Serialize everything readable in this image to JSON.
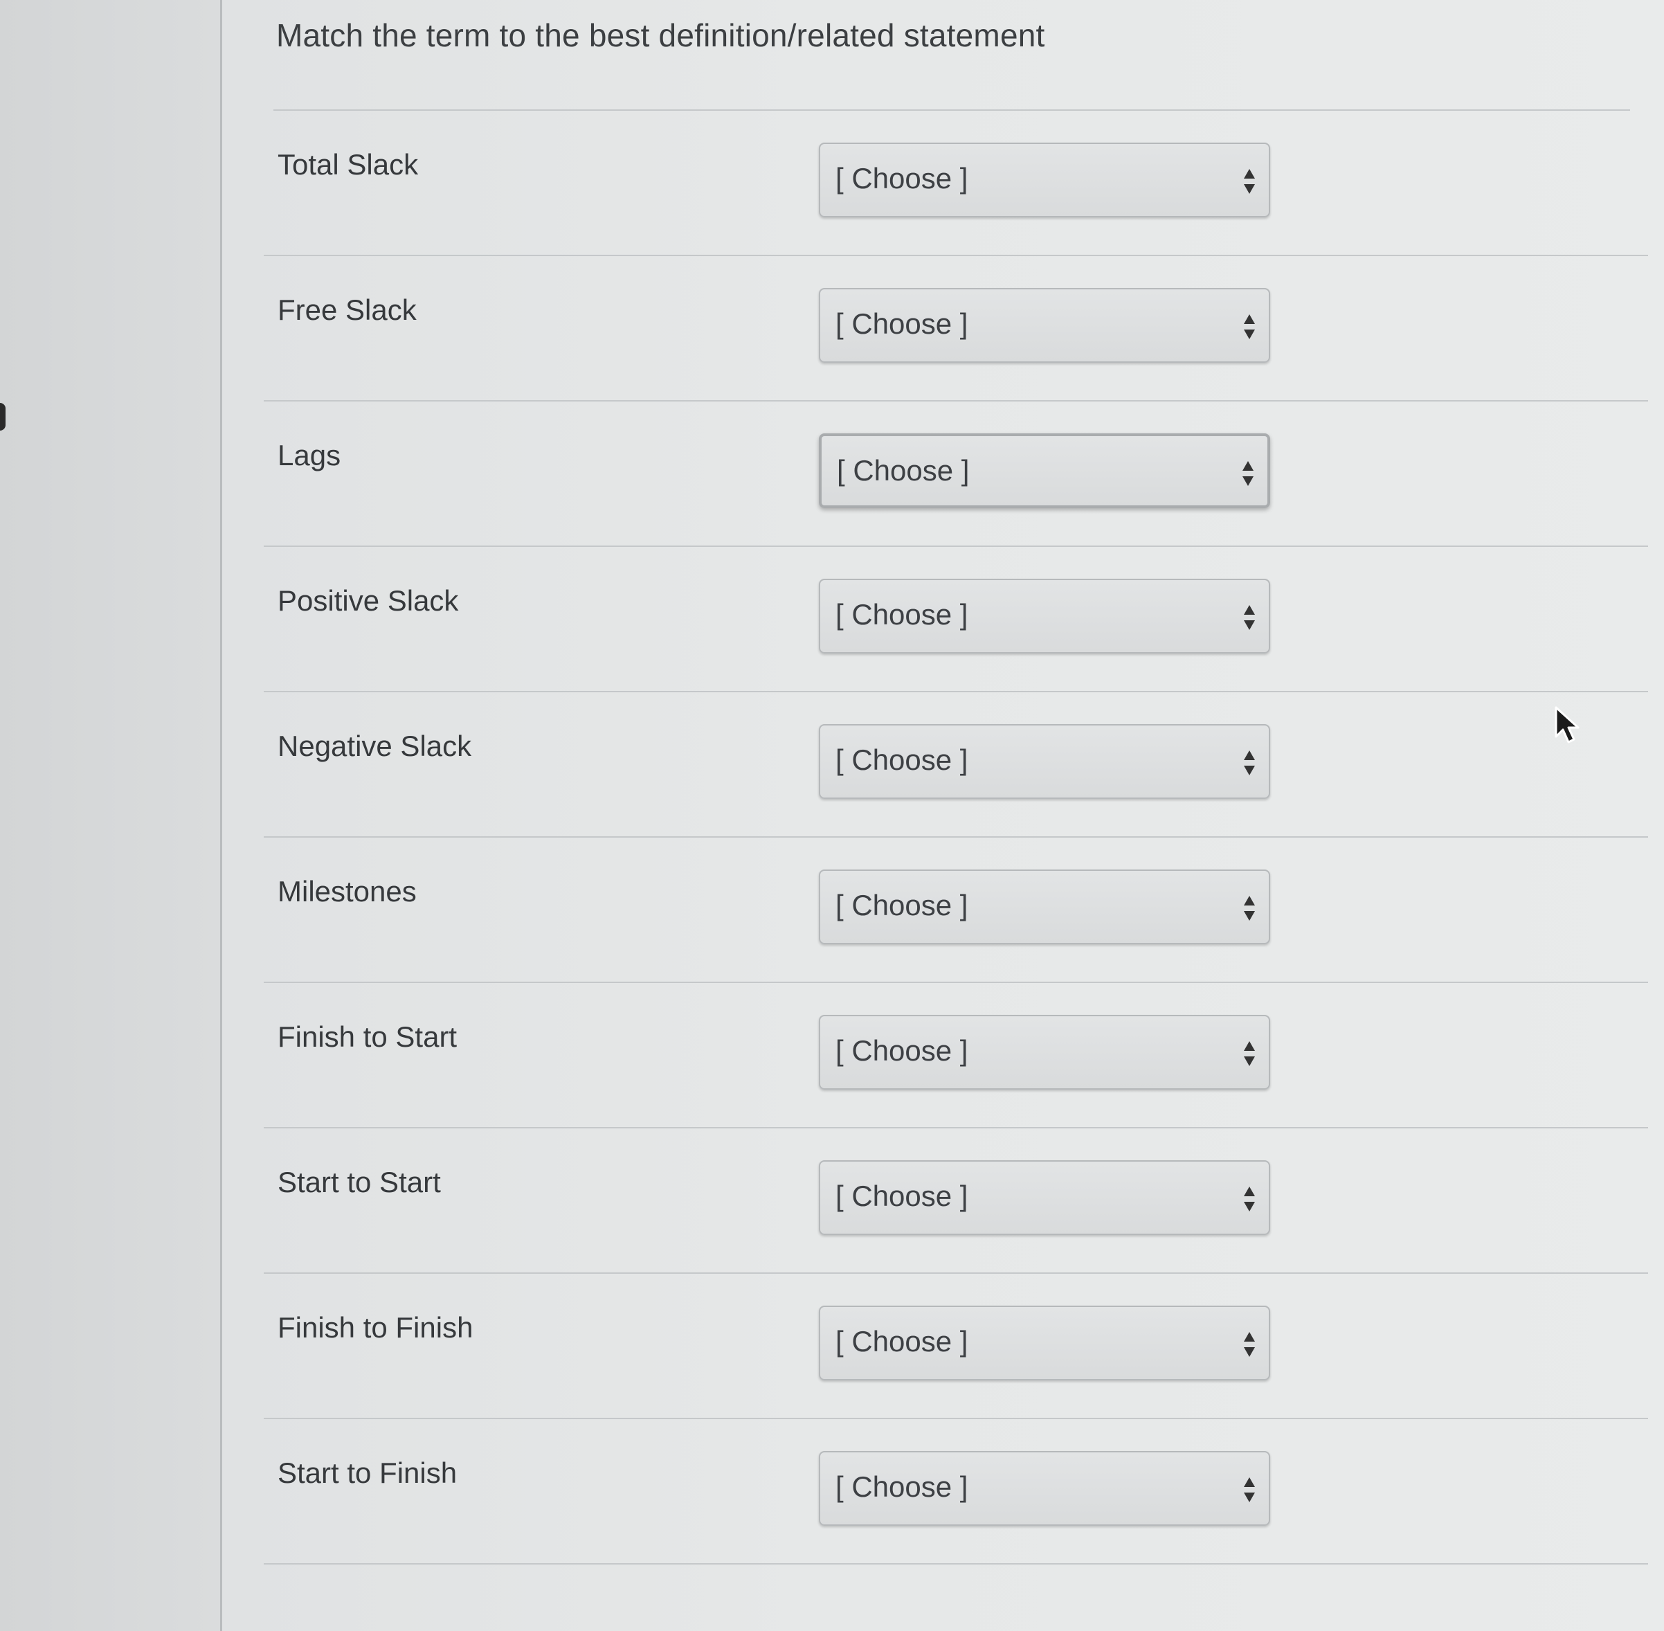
{
  "page": {
    "title": "Match the term to the best definition/related statement"
  },
  "rows": [
    {
      "term": "Total Slack",
      "select_value": "[ Choose ]"
    },
    {
      "term": "Free Slack",
      "select_value": "[ Choose ]"
    },
    {
      "term": "Lags",
      "select_value": "[ Choose ]"
    },
    {
      "term": "Positive Slack",
      "select_value": "[ Choose ]"
    },
    {
      "term": "Negative Slack",
      "select_value": "[ Choose ]"
    },
    {
      "term": "Milestones",
      "select_value": "[ Choose ]"
    },
    {
      "term": "Finish to Start",
      "select_value": "[ Choose ]"
    },
    {
      "term": "Start to Start",
      "select_value": "[ Choose ]"
    },
    {
      "term": "Finish to Finish",
      "select_value": "[ Choose ]"
    },
    {
      "term": "Start to Finish",
      "select_value": "[ Choose ]"
    }
  ],
  "icons": {
    "dropdown": "updown-arrows-icon",
    "pointer": "mouse-pointer-icon"
  },
  "colors": {
    "background": "#e6e8e8",
    "select_fill": "#dcdedf",
    "text": "#36393c"
  }
}
